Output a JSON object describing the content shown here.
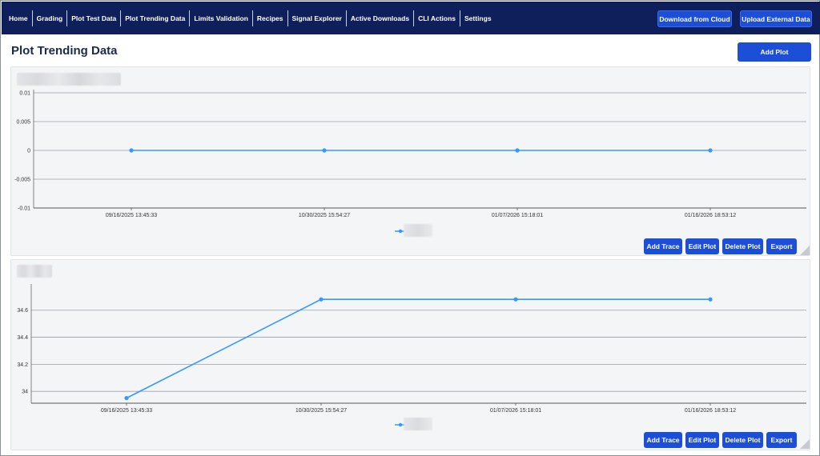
{
  "nav": {
    "items": [
      "Home",
      "Grading",
      "Plot Test Data",
      "Plot Trending Data",
      "Limits Validation",
      "Recipes",
      "Signal Explorer",
      "Active Downloads",
      "CLI Actions",
      "Settings"
    ],
    "download_label": "Download from Cloud",
    "upload_label": "Upload External Data"
  },
  "page": {
    "title": "Plot Trending Data",
    "add_plot_label": "Add Plot"
  },
  "panel_buttons": {
    "add_trace": "Add Trace",
    "edit_plot": "Edit Plot",
    "delete_plot": "Delete Plot",
    "export": "Export"
  },
  "colors": {
    "navbar": "#0f1f5c",
    "button": "#1d4ed8",
    "series": "#3399ff"
  },
  "chart_data": [
    {
      "type": "line",
      "title": "",
      "x": [
        "09/16/2025 13:45:33",
        "10/30/2025 15:54:27",
        "01/07/2026 15:18:01",
        "01/16/2026 18:53:12"
      ],
      "series": [
        {
          "values": [
            0,
            0,
            0,
            0
          ]
        }
      ],
      "ylim": [
        -0.01,
        0.01
      ],
      "yticks": [
        "0.01",
        "0.005",
        "0",
        "-0.005",
        "-0.01"
      ],
      "grid": true,
      "legend": "bottom"
    },
    {
      "type": "line",
      "title": "",
      "x": [
        "09/16/2025 13:45:33",
        "10/30/2025 15:54:27",
        "01/07/2026 15:18:01",
        "01/16/2026 18:53:12"
      ],
      "series": [
        {
          "values": [
            33.95,
            34.68,
            34.68,
            34.68
          ]
        }
      ],
      "ylim": [
        33.93,
        34.77
      ],
      "yticks": [
        "34.6",
        "34.4",
        "34.2",
        "34"
      ],
      "grid": true,
      "legend": "bottom"
    }
  ]
}
